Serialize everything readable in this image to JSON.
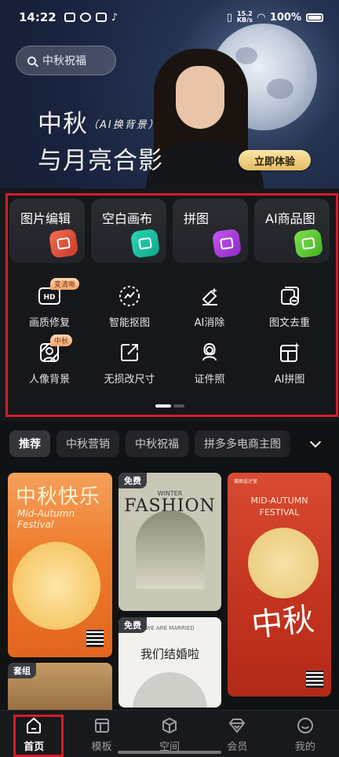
{
  "status_bar": {
    "time": "14:22",
    "net_speed_top": "15.2",
    "net_speed_bottom": "KB/s",
    "battery": "100%"
  },
  "search": {
    "placeholder": "中秋祝福"
  },
  "banner": {
    "title_line1": "中秋",
    "subtitle": "（AI换背景）",
    "title_line2": "与月亮合影",
    "cta": "立即体验"
  },
  "feature_cards": [
    {
      "label": "图片编辑",
      "icon": "image-edit-icon",
      "color": "#e6533c"
    },
    {
      "label": "空白画布",
      "icon": "canvas-icon",
      "color": "#1fc6a6"
    },
    {
      "label": "拼图",
      "icon": "collage-icon",
      "color": "#b040e0"
    },
    {
      "label": "AI商品图",
      "icon": "ai-product-icon",
      "color": "#6ad33e"
    }
  ],
  "tools": [
    {
      "label": "画质修复",
      "badge": "变清晰",
      "icon": "hd-icon"
    },
    {
      "label": "智能抠图",
      "badge": "",
      "icon": "cutout-icon"
    },
    {
      "label": "AI消除",
      "badge": "",
      "icon": "eraser-icon"
    },
    {
      "label": "图文去重",
      "badge": "",
      "icon": "dedupe-icon"
    },
    {
      "label": "人像背景",
      "badge": "中秋",
      "icon": "portrait-bg-icon"
    },
    {
      "label": "无损改尺寸",
      "badge": "",
      "icon": "resize-icon"
    },
    {
      "label": "证件照",
      "badge": "",
      "icon": "id-photo-icon"
    },
    {
      "label": "AI拼图",
      "badge": "",
      "icon": "ai-collage-icon"
    }
  ],
  "tabs": [
    "推荐",
    "中秋营销",
    "中秋祝福",
    "拼多多电商主图"
  ],
  "templates": {
    "mid_autumn": {
      "title": "中秋快乐",
      "en1": "Mid-Autumn",
      "en2": "Festival"
    },
    "fashion": {
      "tag": "免费",
      "head": "WINTER",
      "title": "FASHION"
    },
    "wedding": {
      "tag": "免费",
      "head": "WE ARE MARRIED",
      "title": "我们结婚啦"
    },
    "red": {
      "brand": "美图设计室",
      "en1": "MID-AUTUMN",
      "en2": "FESTIVAL",
      "big": "中秋"
    },
    "set": {
      "tag": "套组"
    }
  },
  "nav": [
    {
      "label": "首页",
      "icon": "home-icon",
      "active": true
    },
    {
      "label": "模板",
      "icon": "template-icon",
      "active": false
    },
    {
      "label": "空间",
      "icon": "cube-icon",
      "active": false
    },
    {
      "label": "会员",
      "icon": "diamond-icon",
      "active": false
    },
    {
      "label": "我的",
      "icon": "profile-icon",
      "active": false
    }
  ],
  "colors": {
    "highlight": "#d21d27",
    "cta": "#e3bc62",
    "background": "#111214"
  }
}
